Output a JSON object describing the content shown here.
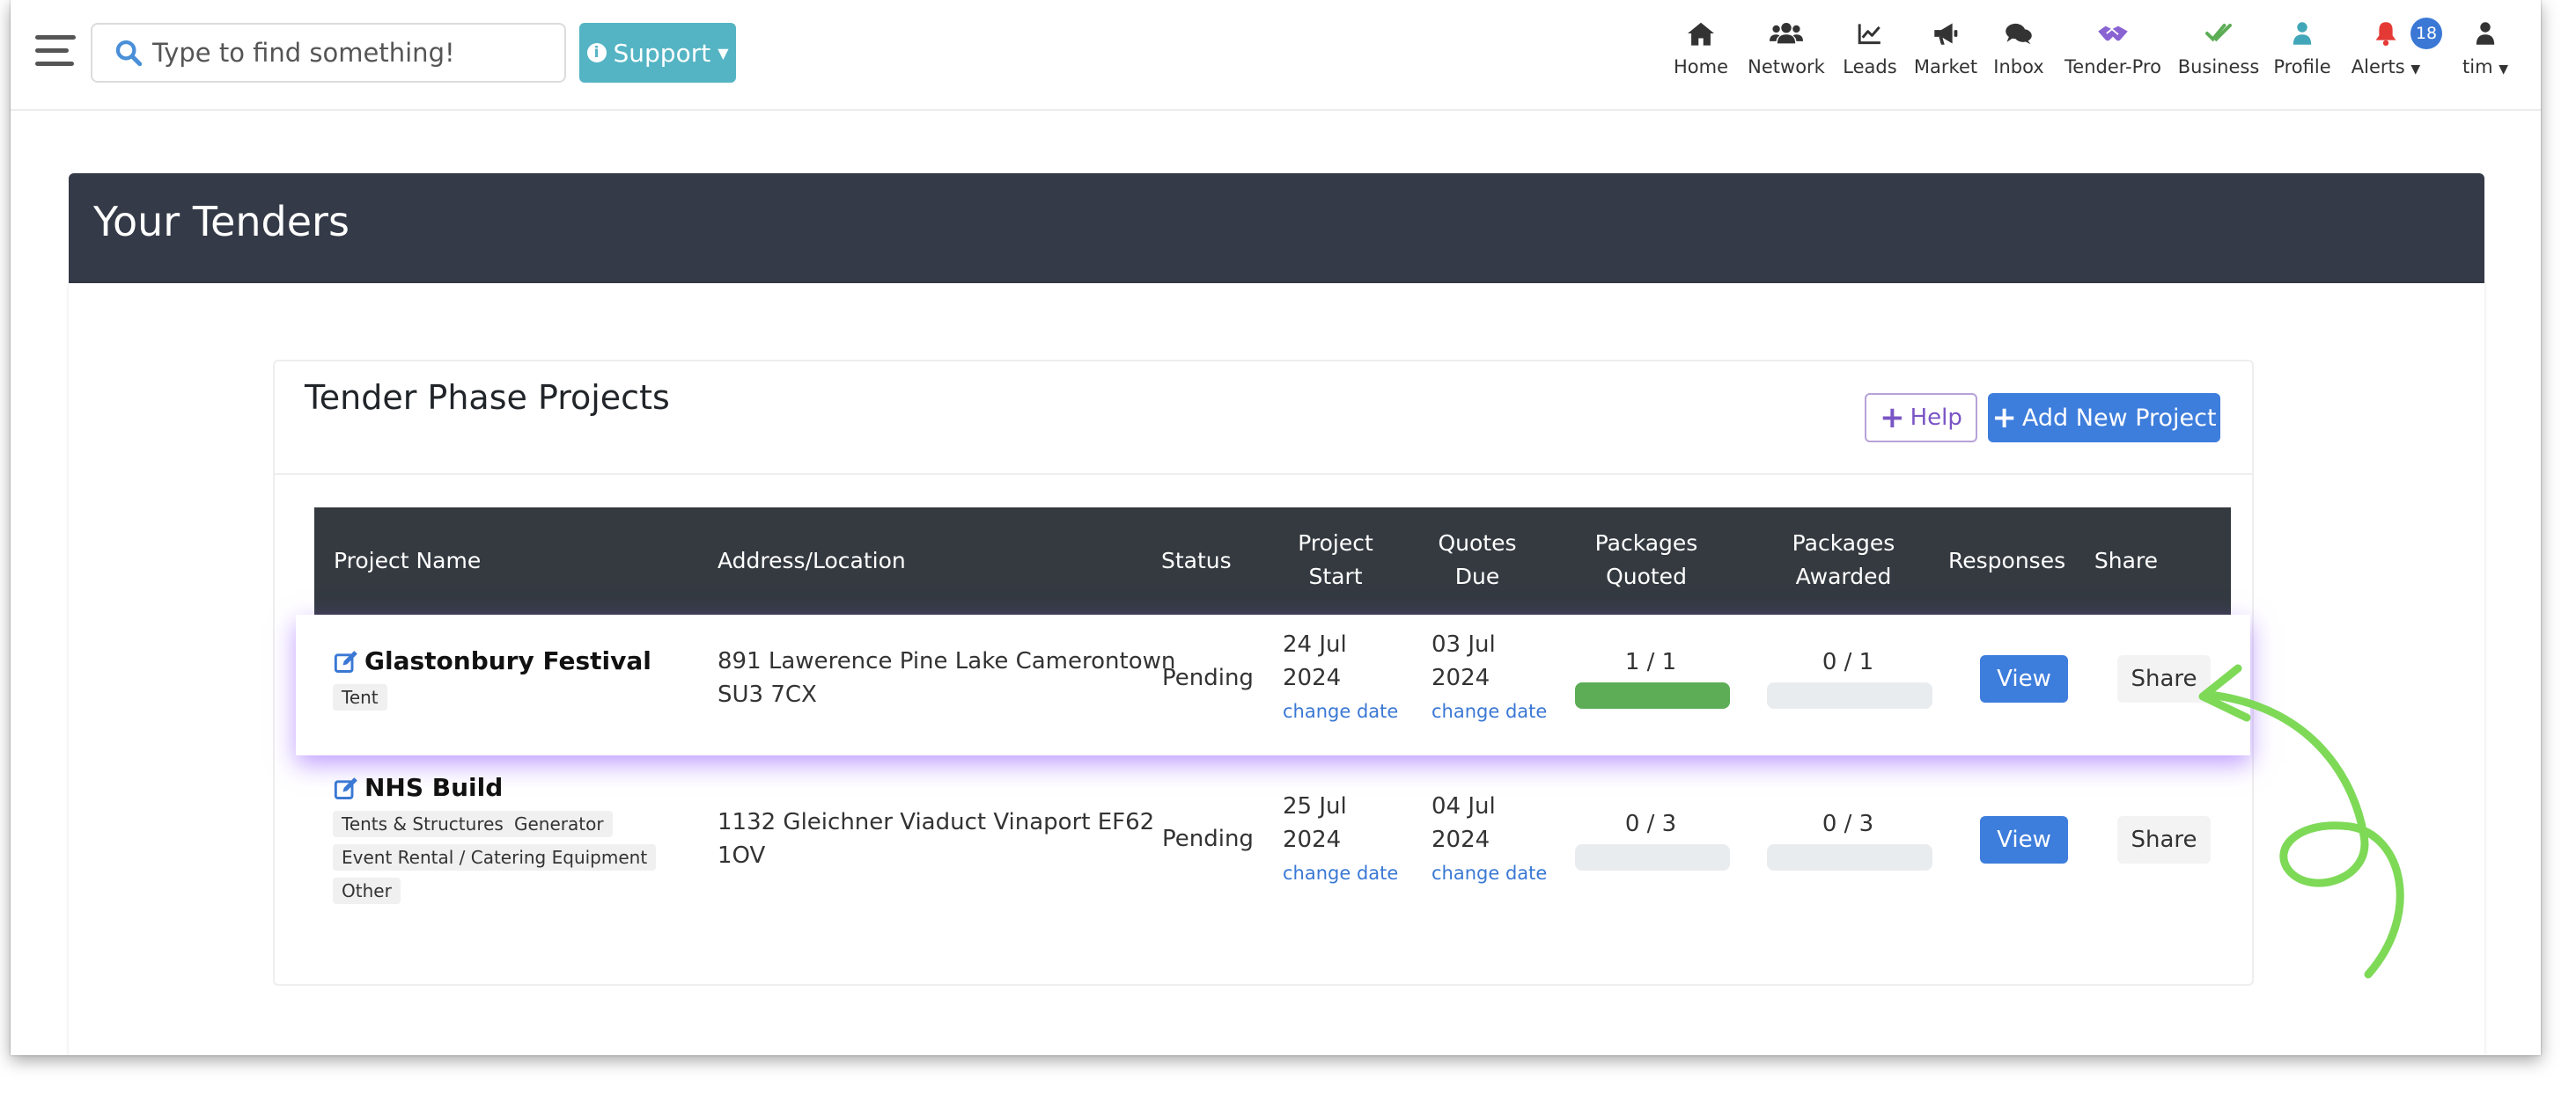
{
  "search": {
    "placeholder": "Type to find something!"
  },
  "support": {
    "label": "Support"
  },
  "nav": {
    "items": [
      {
        "label": "Home",
        "icon": "home-icon"
      },
      {
        "label": "Network",
        "icon": "users-icon"
      },
      {
        "label": "Leads",
        "icon": "chart-line-icon"
      },
      {
        "label": "Market",
        "icon": "megaphone-icon"
      },
      {
        "label": "Inbox",
        "icon": "comments-icon"
      },
      {
        "label": "Tender-Pro",
        "icon": "handshake-icon"
      },
      {
        "label": "Business",
        "icon": "double-check-icon"
      },
      {
        "label": "Profile",
        "icon": "person-icon"
      },
      {
        "label": "Alerts",
        "icon": "bell-icon"
      },
      {
        "label": "tim",
        "icon": "user-icon"
      }
    ],
    "alerts_count": "18"
  },
  "colors": {
    "accent": "#3d7ddc",
    "support": "#54b4c4",
    "header": "#343a47",
    "success": "#5cad56",
    "arrow": "#7ed957",
    "alerts": "#e53935"
  },
  "page": {
    "title": "Your Tenders"
  },
  "card": {
    "title": "Tender Phase Projects",
    "help_label": "Help",
    "add_label": "Add New Project"
  },
  "table": {
    "headers": {
      "project_name": "Project Name",
      "address": "Address/Location",
      "status": "Status",
      "project_start": [
        "Project",
        "Start"
      ],
      "quotes_due": [
        "Quotes",
        "Due"
      ],
      "packages_quoted": [
        "Packages",
        "Quoted"
      ],
      "packages_awarded": [
        "Packages",
        "Awarded"
      ],
      "responses": "Responses",
      "share": "Share"
    },
    "rows": [
      {
        "name": "Glastonbury Festival",
        "tags": [
          "Tent"
        ],
        "address": [
          "891 Lawerence Pine Lake Camerontown",
          "SU3 7CX"
        ],
        "status": "Pending",
        "start": [
          "24 Jul",
          "2024"
        ],
        "due": [
          "03 Jul",
          "2024"
        ],
        "change_label": "change date",
        "quoted": "1 / 1",
        "quoted_fraction": 1,
        "awarded": "0 / 1",
        "awarded_fraction": 0,
        "view_label": "View",
        "share_label": "Share"
      },
      {
        "name": "NHS Build",
        "tags": [
          "Tents & Structures",
          "Generator",
          "Event Rental / Catering Equipment",
          "Other"
        ],
        "address": [
          "1132 Gleichner Viaduct Vinaport EF62",
          "1OV"
        ],
        "status": "Pending",
        "start": [
          "25 Jul",
          "2024"
        ],
        "due": [
          "04 Jul",
          "2024"
        ],
        "change_label": "change date",
        "quoted": "0 / 3",
        "quoted_fraction": 0,
        "awarded": "0 / 3",
        "awarded_fraction": 0,
        "view_label": "View",
        "share_label": "Share"
      }
    ]
  }
}
